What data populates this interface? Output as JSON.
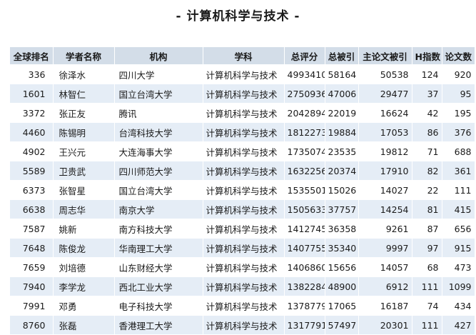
{
  "title": "- 计算机科学与技术 -",
  "table": {
    "headers": {
      "rank": "全球排名",
      "name": "学者名称",
      "org": "机构",
      "subject": "学科",
      "score": "总评分",
      "citations": "总被引",
      "main_citations": "主论文被引",
      "h_index": "H指数",
      "papers": "论文数"
    },
    "rows": [
      {
        "rank": "336",
        "name": "徐泽水",
        "org": "四川大学",
        "subject": "计算机科学与技术",
        "score": "4993410",
        "citations": "58164",
        "main_citations": "50538",
        "h_index": "124",
        "papers": "920"
      },
      {
        "rank": "1601",
        "name": "林智仁",
        "org": "国立台湾大学",
        "subject": "计算机科学与技术",
        "score": "2750936",
        "citations": "47006",
        "main_citations": "29477",
        "h_index": "37",
        "papers": "95"
      },
      {
        "rank": "3372",
        "name": "张正友",
        "org": "腾讯",
        "subject": "计算机科学与技术",
        "score": "2042894",
        "citations": "22019",
        "main_citations": "16624",
        "h_index": "42",
        "papers": "195"
      },
      {
        "rank": "4460",
        "name": "陈锡明",
        "org": "台湾科技大学",
        "subject": "计算机科学与技术",
        "score": "1812273",
        "citations": "19884",
        "main_citations": "17053",
        "h_index": "86",
        "papers": "376"
      },
      {
        "rank": "4902",
        "name": "王兴元",
        "org": "大连海事大学",
        "subject": "计算机科学与技术",
        "score": "1735074",
        "citations": "23535",
        "main_citations": "19812",
        "h_index": "71",
        "papers": "688"
      },
      {
        "rank": "5589",
        "name": "卫贵武",
        "org": "四川师范大学",
        "subject": "计算机科学与技术",
        "score": "1632256",
        "citations": "20374",
        "main_citations": "17910",
        "h_index": "82",
        "papers": "361"
      },
      {
        "rank": "6373",
        "name": "张智星",
        "org": "国立台湾大学",
        "subject": "计算机科学与技术",
        "score": "1535501",
        "citations": "15026",
        "main_citations": "14027",
        "h_index": "22",
        "papers": "111"
      },
      {
        "rank": "6638",
        "name": "周志华",
        "org": "南京大学",
        "subject": "计算机科学与技术",
        "score": "1505633",
        "citations": "37757",
        "main_citations": "14254",
        "h_index": "81",
        "papers": "415"
      },
      {
        "rank": "7587",
        "name": "姚新",
        "org": "南方科技大学",
        "subject": "计算机科学与技术",
        "score": "1412745",
        "citations": "36358",
        "main_citations": "9261",
        "h_index": "87",
        "papers": "656"
      },
      {
        "rank": "7648",
        "name": "陈俊龙",
        "org": "华南理工大学",
        "subject": "计算机科学与技术",
        "score": "1407755",
        "citations": "35340",
        "main_citations": "9997",
        "h_index": "97",
        "papers": "915"
      },
      {
        "rank": "7659",
        "name": "刘培德",
        "org": "山东财经大学",
        "subject": "计算机科学与技术",
        "score": "1406860",
        "citations": "15656",
        "main_citations": "14057",
        "h_index": "68",
        "papers": "473"
      },
      {
        "rank": "7940",
        "name": "李学龙",
        "org": "西北工业大学",
        "subject": "计算机科学与技术",
        "score": "1382284",
        "citations": "48900",
        "main_citations": "6912",
        "h_index": "111",
        "papers": "1099"
      },
      {
        "rank": "7991",
        "name": "邓勇",
        "org": "电子科技大学",
        "subject": "计算机科学与技术",
        "score": "1378779",
        "citations": "17065",
        "main_citations": "16187",
        "h_index": "74",
        "papers": "434"
      },
      {
        "rank": "8760",
        "name": "张磊",
        "org": "香港理工大学",
        "subject": "计算机科学与技术",
        "score": "1317791",
        "citations": "57497",
        "main_citations": "20301",
        "h_index": "111",
        "papers": "427"
      }
    ]
  }
}
